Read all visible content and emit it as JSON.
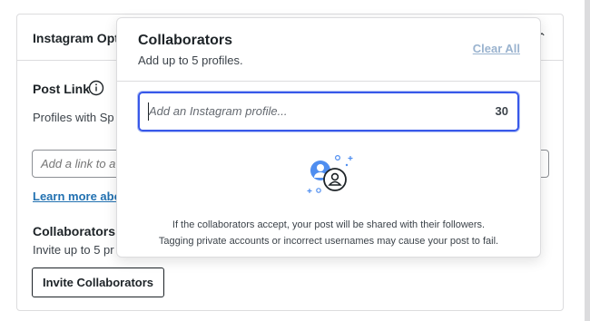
{
  "panel": {
    "title": "Instagram Options",
    "post_link": {
      "label": "Post Link",
      "description": "Profiles with Sp site.",
      "input_placeholder": "Add a link to a",
      "learn_more": "Learn more abo"
    },
    "collaborators": {
      "label": "Collaborators",
      "description": "Invite up to 5 pr",
      "invite_button": "Invite Collaborators"
    }
  },
  "popover": {
    "title": "Collaborators",
    "subtitle": "Add up to 5 profiles.",
    "clear_all": "Clear All",
    "input": {
      "placeholder": "Add an Instagram profile...",
      "char_count": "30"
    },
    "illustration_icon": "collaborators-illustration-icon",
    "note_line1": "If the collaborators accept, your post will be shared with their followers.",
    "note_line2": "Tagging private accounts or incorrect usernames may cause your post to fail."
  },
  "colors": {
    "accent": "#3858e9",
    "link": "#2271b1",
    "clear_all": "#9ab3cf",
    "text": "#1d2327"
  }
}
